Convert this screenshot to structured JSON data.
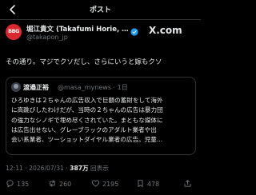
{
  "header": {
    "title": "ポスト"
  },
  "author": {
    "avatar_text": "BBG",
    "display_name": "堀江貴文 (Takafumi Horie, ...",
    "handle": "@takapon_jp",
    "brand_mark": "X.com"
  },
  "tweet": {
    "text": "その通り。マジでクソだし、さらにいうと嫁もクソ"
  },
  "quote": {
    "name": "渡邉正裕",
    "handle_time": "@masa_mynews · 1日",
    "lines": [
      "ひろゆきは２ちゃんの広告収入で巨額の蓄財をして海外",
      "に高跳びしたわけだが、当時の２ちゃんの広告は暴力団",
      "の強力なシノギで埋め尽くされていた。まともな媒体に",
      "は広告出せない、グレーブラックのアダルト業者や出",
      "会い系業者、ツーショットダイヤル業者の広告。児童..."
    ]
  },
  "meta": {
    "time": "12:11",
    "date": "2026/07/31",
    "views_count": "387万",
    "views_label": "回表示"
  },
  "actions": {
    "reply_count": "135",
    "repost_count": "260",
    "like_count": "2195",
    "bookmark_count": "478"
  }
}
